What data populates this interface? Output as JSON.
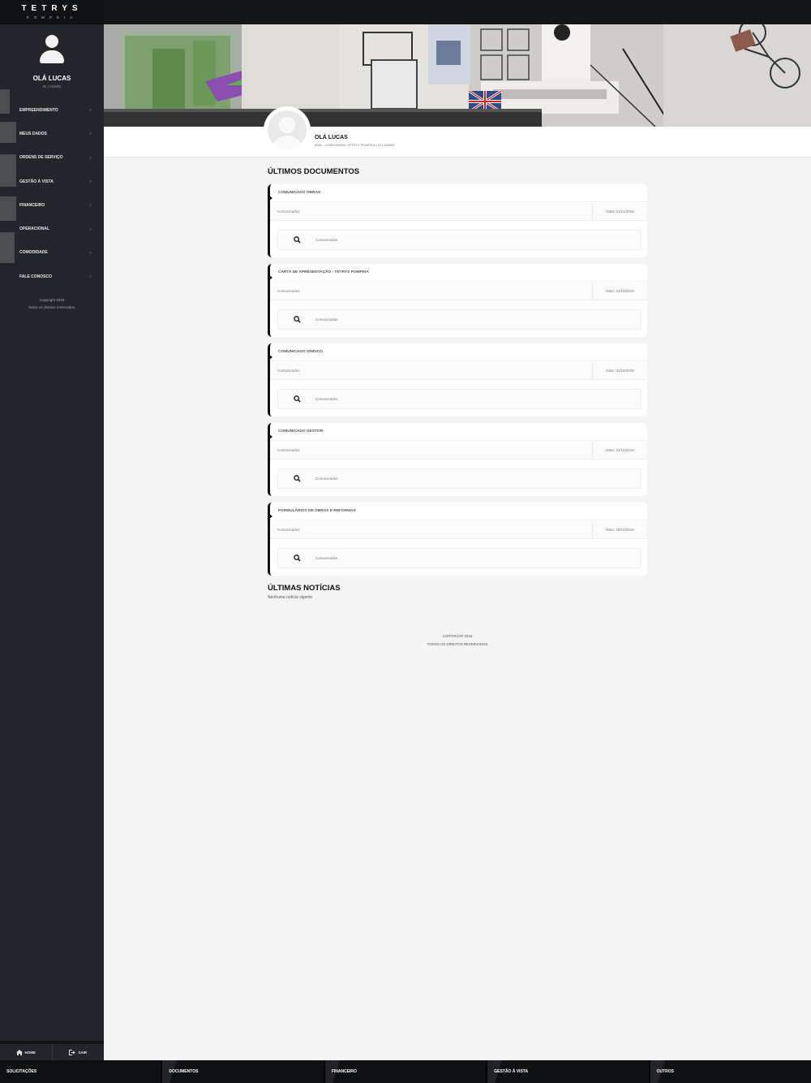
{
  "app": {
    "logo_main": "TETRYS",
    "logo_sub": "POMPEIA"
  },
  "sidebar": {
    "greeting": "OLÁ LUCAS",
    "role": "ID | ADMIN",
    "items": [
      {
        "label": "EMPREENDIMENTO"
      },
      {
        "label": "MEUS DADOS"
      },
      {
        "label": "ORDENS DE SERVIÇO"
      },
      {
        "label": "GESTÃO À VISTA"
      },
      {
        "label": "FINANCEIRO"
      },
      {
        "label": "OPERACIONAL"
      },
      {
        "label": "COMODIDADE"
      },
      {
        "label": "FALE CONOSCO"
      }
    ],
    "copyright_line1": "Copyright 2018",
    "copyright_line2": "Todos os direitos reservados.",
    "footer_home": "HOME",
    "footer_logout": "SAIR"
  },
  "profile": {
    "name": "OLÁ LUCAS",
    "subtitle": "6356 - CONDOMINIO TETRYS POMPEIA | ID | ADMIN"
  },
  "documents": {
    "title": "ÚLTIMOS DOCUMENTOS",
    "items": [
      {
        "title": "COMUNICADO OBRAS",
        "category": "Comunicados",
        "date": "Data: 01/11/2018",
        "link_label": "Comunicados"
      },
      {
        "title": "CARTA DE APRESENTAÇÃO - TETRYS POMPEIA",
        "category": "Comunicados",
        "date": "Data: 31/10/2018",
        "link_label": "Comunicados"
      },
      {
        "title": "COMUNICADO SINDICO",
        "category": "Comunicados",
        "date": "Data: 31/10/2018",
        "link_label": "Comunicados"
      },
      {
        "title": "COMUNICADO GESTOR",
        "category": "Comunicados",
        "date": "Data: 31/10/2018",
        "link_label": "Comunicados"
      },
      {
        "title": "FORMULÁRIOS DE OBRAS E REFORMAS",
        "category": "Comunicados",
        "date": "Data: 29/10/2018",
        "link_label": "Comunicados"
      }
    ]
  },
  "news": {
    "title": "ÚLTIMAS NOTÍCIAS",
    "empty": "Nenhuma notícia vigente"
  },
  "footer": {
    "line1": "COPYRIGHT 2018",
    "line2": "TODOS OS DIREITOS RESERVADOS"
  },
  "bottom_nav": [
    {
      "label": "SOLICITAÇÕES"
    },
    {
      "label": "DOCUMENTOS"
    },
    {
      "label": "FINANCEIRO"
    },
    {
      "label": "GESTÃO À VISTA"
    },
    {
      "label": "OUTROS"
    }
  ],
  "colors": {
    "sidebar_bg": "#23252b",
    "dark_bar": "#0f1012",
    "accent_border": "#111111",
    "content_bg": "#f4f4f4"
  },
  "icons": {
    "search": "search-icon",
    "plus": "plus-icon",
    "home": "home-icon",
    "logout": "logout-icon"
  }
}
